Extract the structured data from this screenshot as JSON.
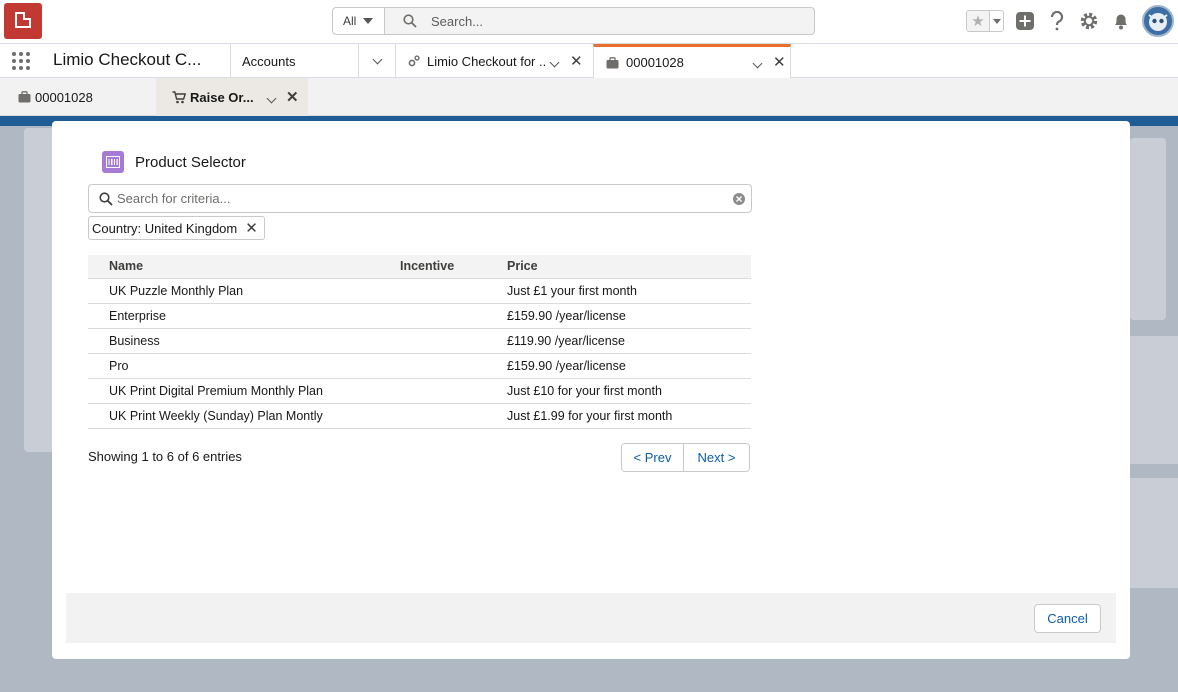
{
  "header": {
    "search_scope": "All",
    "search_placeholder": "Search..."
  },
  "nav": {
    "app_name": "Limio Checkout C...",
    "tabs": [
      {
        "label": "Accounts"
      },
      {
        "label": "Limio Checkout for ..."
      },
      {
        "label": "00001028"
      }
    ]
  },
  "subtabs": [
    {
      "label": "00001028"
    },
    {
      "label": "Raise Or..."
    }
  ],
  "modal": {
    "title": "Product Selector",
    "search_placeholder": "Search for criteria...",
    "filter_pill": "Country: United Kingdom",
    "table": {
      "columns": [
        "Name",
        "Incentive",
        "Price"
      ],
      "rows": [
        {
          "name": "UK Puzzle Monthly Plan",
          "incentive": "",
          "price": "Just £1 your first month"
        },
        {
          "name": "Enterprise",
          "incentive": "",
          "price": "£159.90 /year/license"
        },
        {
          "name": "Business",
          "incentive": "",
          "price": "£119.90 /year/license"
        },
        {
          "name": "Pro",
          "incentive": "",
          "price": "£159.90 /year/license"
        },
        {
          "name": "UK Print Digital Premium Monthly Plan",
          "incentive": "",
          "price": "Just £10 for your first month"
        },
        {
          "name": "UK Print Weekly (Sunday) Plan Montly",
          "incentive": "",
          "price": "Just £1.99 for your first month"
        }
      ]
    },
    "entries_text": "Showing 1 to 6 of 6 entries",
    "prev_label": "< Prev",
    "next_label": "Next >",
    "cancel_label": "Cancel"
  },
  "colors": {
    "brand_red": "#c23934",
    "active_tab_accent": "#e86e2d",
    "link_blue": "#0b5cab",
    "product_icon": "#a77ad6"
  }
}
